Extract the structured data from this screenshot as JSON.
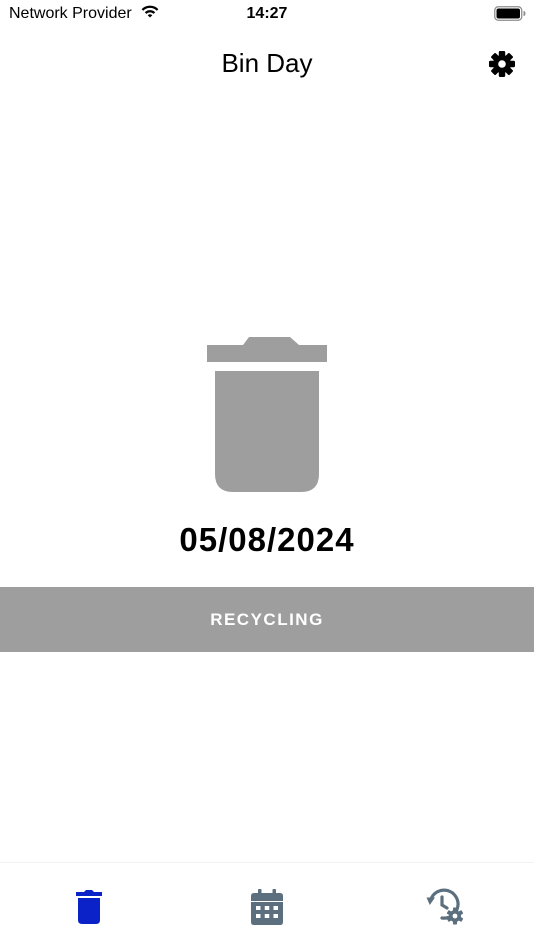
{
  "status_bar": {
    "carrier": "Network Provider",
    "time": "14:27"
  },
  "nav": {
    "title": "Bin Day"
  },
  "collection": {
    "date": "05/08/2024",
    "bin_type": "RECYCLING",
    "bin_color": "#9e9e9e"
  },
  "tabs": [
    {
      "icon": "trash-icon",
      "active": true,
      "color": "#0a22c8"
    },
    {
      "icon": "calendar-icon",
      "active": false,
      "color": "#5b6f7f"
    },
    {
      "icon": "history-settings-icon",
      "active": false,
      "color": "#5b6f7f"
    }
  ],
  "colors": {
    "accent": "#0a22c8",
    "inactive_tab": "#5b6f7f",
    "banner": "#9e9e9e"
  }
}
